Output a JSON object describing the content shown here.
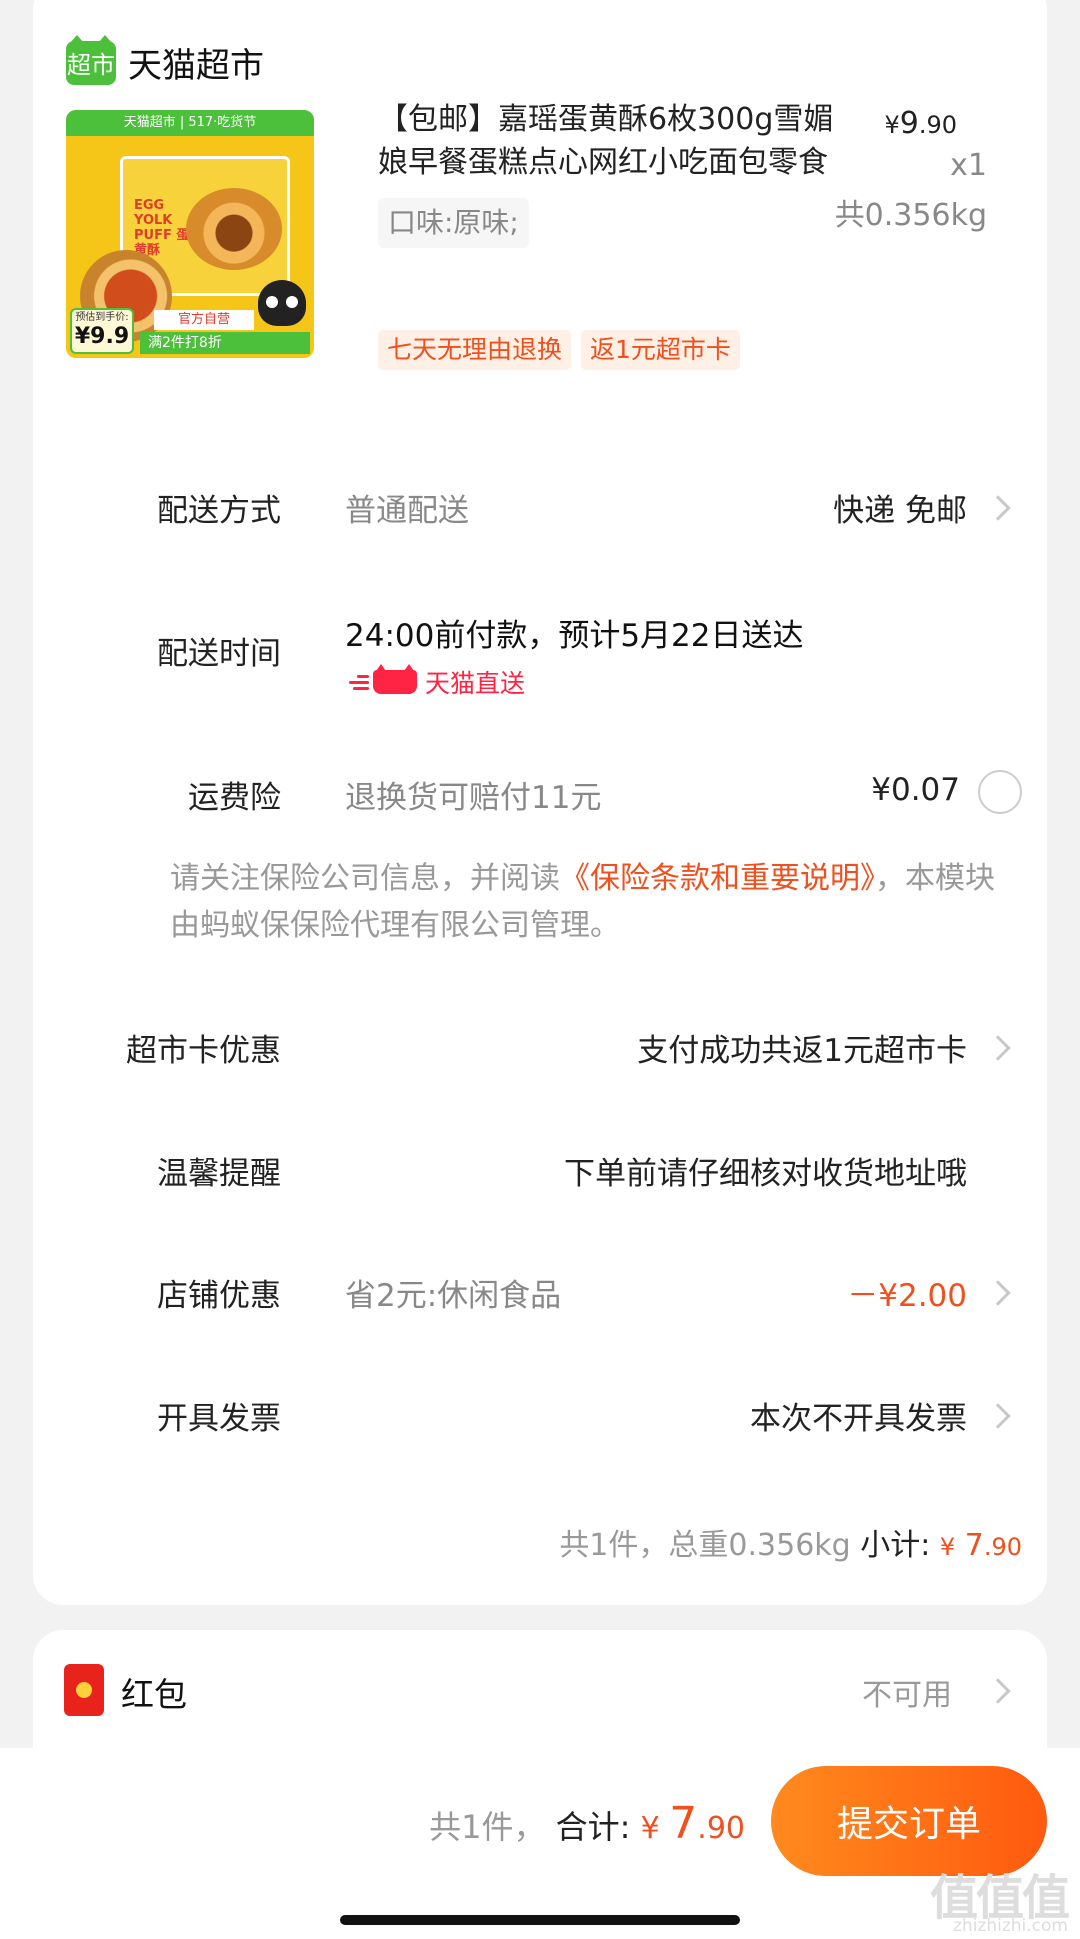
{
  "store": {
    "logo_text": "超市",
    "name": "天猫超市",
    "brand_color": "#4cbf3b"
  },
  "product": {
    "thumb": {
      "banner": "天猫超市 | 517·吃货节",
      "box_title": "EGG YOLK PUFF 蛋黄酥",
      "price_label": "预估到手价:",
      "price": "¥9.9",
      "promo_official": "官方自营",
      "promo_discount": "满2件打8折"
    },
    "title": "【包邮】嘉瑶蛋黄酥6枚300g雪媚娘早餐蛋糕点心网红小吃面包零食",
    "price_currency": "¥",
    "price_int": "9",
    "price_dec": ".90",
    "quantity": "x1",
    "weight": "共0.356kg",
    "flavor": "口味:原味;",
    "tags": [
      "七天无理由退换",
      "返1元超市卡"
    ]
  },
  "delivery_method": {
    "label": "配送方式",
    "value": "普通配送",
    "detail": "快递 免邮"
  },
  "delivery_time": {
    "label": "配送时间",
    "value": "24:00前付款，预计5月22日送达",
    "badge": "天猫直送"
  },
  "shipping_insurance": {
    "label": "运费险",
    "desc": "退换货可赔付11元",
    "price": "¥0.07"
  },
  "insurance_notice": {
    "text_before": "请关注保险公司信息，并阅读",
    "link": "《保险条款和重要说明》",
    "text_after": "，本模块由蚂蚁保保险代理有限公司管理。"
  },
  "market_card": {
    "label": "超市卡优惠",
    "value": "支付成功共返1元超市卡"
  },
  "reminder": {
    "label": "温馨提醒",
    "value": "下单前请仔细核对收货地址哦"
  },
  "shop_discount": {
    "label": "店铺优惠",
    "desc": "省2元:休闲食品",
    "value": "－¥2.00"
  },
  "invoice": {
    "label": "开具发票",
    "value": "本次不开具发票"
  },
  "subtotal": {
    "summary": "共1件，总重0.356kg",
    "label": "小计:",
    "currency": "¥",
    "amount_int": "7",
    "amount_dec": ".90"
  },
  "red_packet": {
    "label": "红包",
    "value": "不可用"
  },
  "bottom_bar": {
    "count": "共1件，",
    "total_label": "合计:",
    "currency": "¥",
    "amount_int": "7",
    "amount_dec": ".90",
    "submit_label": "提交订单"
  },
  "watermark": {
    "text": "值值值",
    "url": "zhizhizhi.com"
  },
  "colors": {
    "accent": "#f0501e",
    "tmall_red": "#ff2444"
  }
}
